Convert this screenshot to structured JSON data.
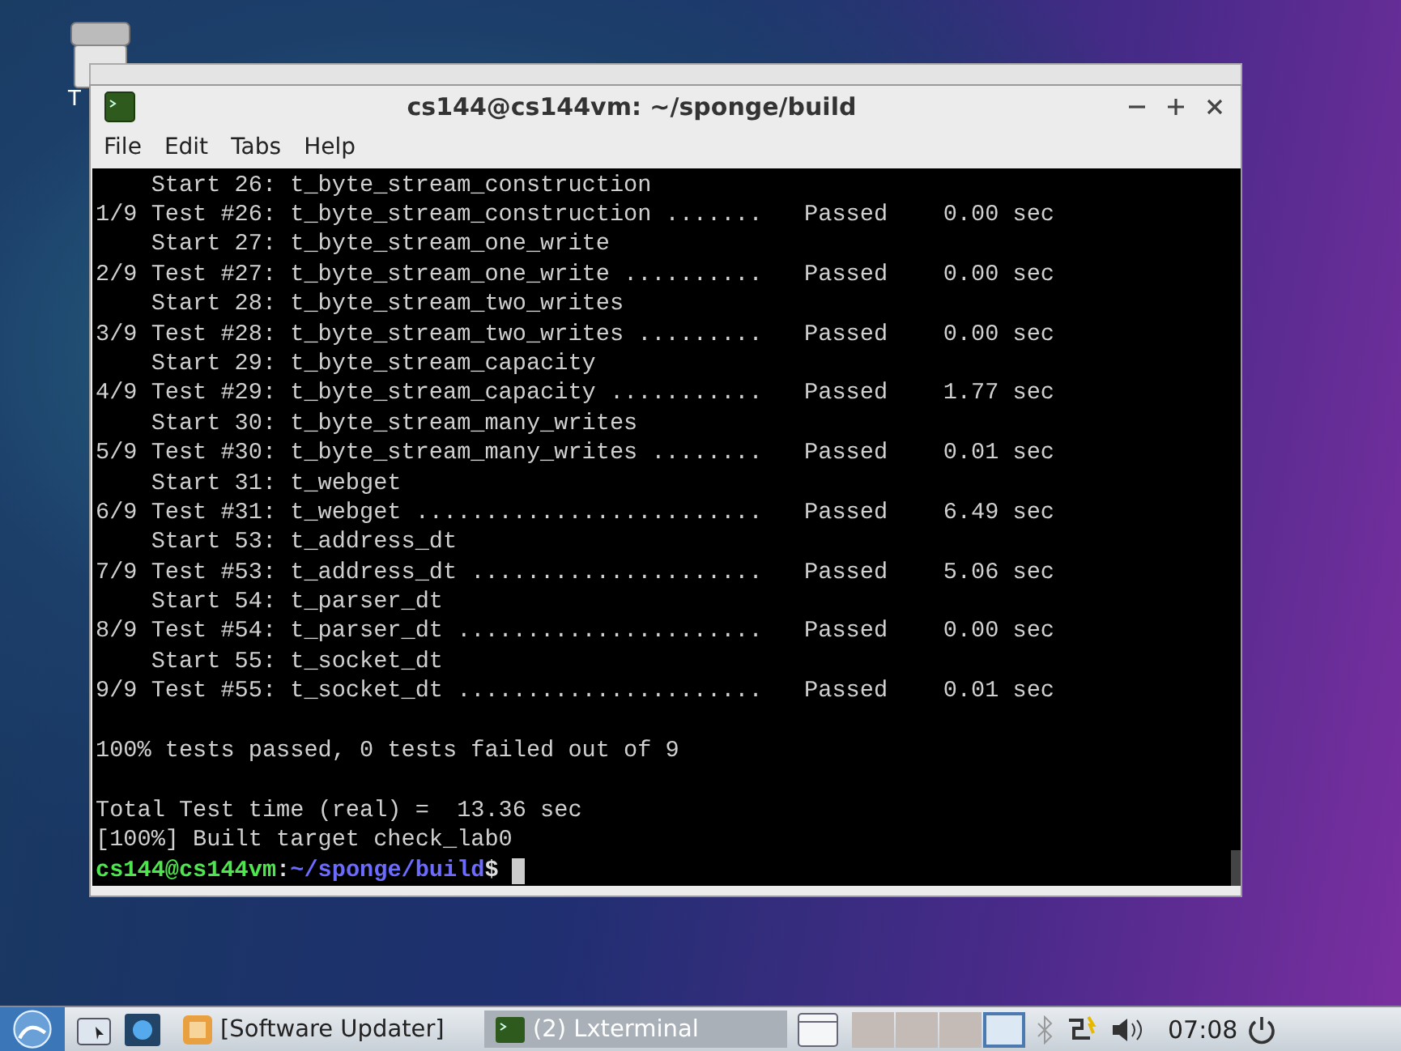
{
  "desktop": {
    "icon_label": "T"
  },
  "window": {
    "title": "cs144@cs144vm: ~/sponge/build",
    "menu": [
      "File",
      "Edit",
      "Tabs",
      "Help"
    ]
  },
  "terminal": {
    "lines": [
      {
        "kind": "text",
        "text": "    Start 26: t_byte_stream_construction"
      },
      {
        "kind": "text",
        "text": "1/9 Test #26: t_byte_stream_construction .......   Passed    0.00 sec"
      },
      {
        "kind": "text",
        "text": "    Start 27: t_byte_stream_one_write"
      },
      {
        "kind": "text",
        "text": "2/9 Test #27: t_byte_stream_one_write ..........   Passed    0.00 sec"
      },
      {
        "kind": "text",
        "text": "    Start 28: t_byte_stream_two_writes"
      },
      {
        "kind": "text",
        "text": "3/9 Test #28: t_byte_stream_two_writes .........   Passed    0.00 sec"
      },
      {
        "kind": "text",
        "text": "    Start 29: t_byte_stream_capacity"
      },
      {
        "kind": "text",
        "text": "4/9 Test #29: t_byte_stream_capacity ...........   Passed    1.77 sec"
      },
      {
        "kind": "text",
        "text": "    Start 30: t_byte_stream_many_writes"
      },
      {
        "kind": "text",
        "text": "5/9 Test #30: t_byte_stream_many_writes ........   Passed    0.01 sec"
      },
      {
        "kind": "text",
        "text": "    Start 31: t_webget"
      },
      {
        "kind": "text",
        "text": "6/9 Test #31: t_webget .........................   Passed    6.49 sec"
      },
      {
        "kind": "text",
        "text": "    Start 53: t_address_dt"
      },
      {
        "kind": "text",
        "text": "7/9 Test #53: t_address_dt .....................   Passed    5.06 sec"
      },
      {
        "kind": "text",
        "text": "    Start 54: t_parser_dt"
      },
      {
        "kind": "text",
        "text": "8/9 Test #54: t_parser_dt ......................   Passed    0.00 sec"
      },
      {
        "kind": "text",
        "text": "    Start 55: t_socket_dt"
      },
      {
        "kind": "text",
        "text": "9/9 Test #55: t_socket_dt ......................   Passed    0.01 sec"
      },
      {
        "kind": "blank"
      },
      {
        "kind": "text",
        "text": "100% tests passed, 0 tests failed out of 9"
      },
      {
        "kind": "blank"
      },
      {
        "kind": "text",
        "text": "Total Test time (real) =  13.36 sec"
      },
      {
        "kind": "text",
        "text": "[100%] Built target check_lab0"
      },
      {
        "kind": "prompt",
        "user": "cs144@cs144vm",
        "sep": ":",
        "path": "~/sponge/build",
        "symbol": "$"
      }
    ]
  },
  "taskbar": {
    "tasks": [
      {
        "label": "[Software Updater]",
        "selected": false,
        "kind": "updater"
      },
      {
        "label": "(2) Lxterminal",
        "selected": true,
        "kind": "terminal"
      }
    ],
    "clock": "07:08"
  }
}
